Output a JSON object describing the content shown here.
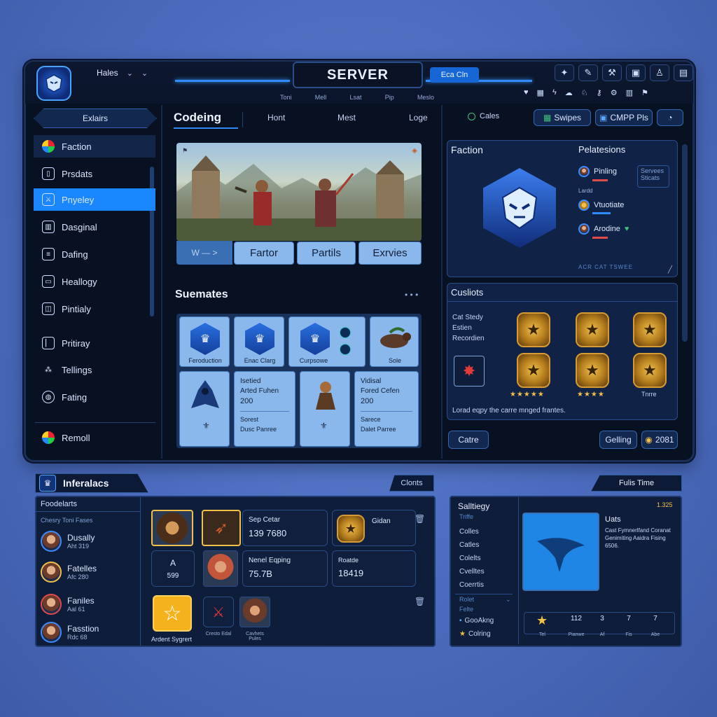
{
  "colors": {
    "accent": "#1a86ff",
    "gold": "#f1c04a",
    "panel": "#0b1426"
  },
  "header": {
    "dropdown_label": "Hales",
    "title": "SERVER",
    "sub_links": [
      "Toni",
      "Mell",
      "Lsat",
      "Pip",
      "Meslo"
    ],
    "pill_label": "Eca Cln",
    "icons": [
      "gamepad-icon",
      "pen-icon",
      "wrench-icon",
      "image-icon",
      "person-icon",
      "chart-icon"
    ],
    "sub_icons": [
      "heart-icon",
      "grid-icon",
      "bolt-icon",
      "cloud-icon",
      "person-icon",
      "key-icon",
      "gear-icon",
      "book-icon",
      "flag-icon"
    ]
  },
  "sidebar": {
    "header": "Exlairs",
    "items": [
      {
        "label": "Faction",
        "icon": "globe-icon"
      },
      {
        "label": "Prsdats",
        "icon": "document-icon"
      },
      {
        "label": "Pnyeley",
        "icon": "sword-icon"
      },
      {
        "label": "Dasginal",
        "icon": "book-icon"
      },
      {
        "label": "Dafing",
        "icon": "list-icon"
      },
      {
        "label": "Heallogy",
        "icon": "heal-icon"
      },
      {
        "label": "Pintialy",
        "icon": "cup-icon"
      },
      {
        "label": "Pritiray",
        "icon": "bar-icon"
      },
      {
        "label": "Tellings",
        "icon": "network-icon"
      },
      {
        "label": "Fating",
        "icon": "bell-icon"
      }
    ],
    "footer": "Remoll"
  },
  "center": {
    "tabs": [
      "Codeing",
      "Hont",
      "Mest",
      "Loge"
    ],
    "hero_buttons": {
      "nav": "W — >",
      "b1": "Fartor",
      "b2": "Partils",
      "b3": "Exrvies"
    },
    "section_title": "Suemates",
    "grid_top": [
      "Feroduction",
      "Enac Clarg",
      "Curpsowe",
      "Sole"
    ],
    "grid_bottom": [
      {
        "title": "Isetied",
        "line": "Arted Fuhen",
        "value": "200",
        "caption": "Sorest",
        "sub": "Dusc Panree"
      },
      {
        "title": "Vidisal",
        "line": "Fored Cefen",
        "value": "200",
        "caption": "Sarece",
        "sub": "Dalet Parree"
      }
    ]
  },
  "right_top": {
    "pill": "Cales",
    "buttons": [
      "Swipes",
      "CMPP Pls"
    ],
    "faction_title": "Faction",
    "pelations_title": "Pelatesions",
    "members": [
      {
        "name": "Pinling",
        "tag": "Servees Sticats"
      },
      {
        "name": "Vtuotiate"
      },
      {
        "name": "Arodine"
      }
    ],
    "muted_label": "Lardd",
    "footer": "ACR CAT TSWEE"
  },
  "customs": {
    "title": "Cusliots",
    "labels": [
      "Cat Stedy",
      "Estien",
      "Recordien"
    ],
    "caption": "Tnrre",
    "footer": "Lorad eqpy the carre mnged frantes.",
    "left_btn": "Catre",
    "right_btn": "Gelling",
    "count": "2081"
  },
  "bottom_left": {
    "header": "Inferalacs",
    "tag": "Clonts",
    "col_title": "Foodelarts",
    "subtitle": "Chesry Toni Fases",
    "players": [
      {
        "name": "Dusally",
        "meta": "Aht 319"
      },
      {
        "name": "Fatelles",
        "meta": "Afc 280"
      },
      {
        "name": "Faniles",
        "meta": "Aal 61"
      },
      {
        "name": "Fasstion",
        "meta": "Rdc 68"
      }
    ],
    "item1": {
      "title": "Sep Cetar",
      "value": "139 7680"
    },
    "item2": {
      "title": "A",
      "value": "599"
    },
    "item3": {
      "title": "Nenel Eqping",
      "value": "75.7B"
    },
    "item4": {
      "title": "Gidan"
    },
    "item5": {
      "title": "Roatde",
      "value": "18419"
    },
    "star_label": "Ardent Sygrert",
    "mini1": "Cresto Edal",
    "mini2": "Cavhets Pules"
  },
  "bottom_right": {
    "header": "Fulis Time",
    "title": "Salltiegy",
    "price": "1.325",
    "subhead": "Triffe",
    "list": [
      "Colles",
      "Catles",
      "Colelts",
      "Cvelltes",
      "Coerrtis"
    ],
    "section": "Rolet",
    "sec_items": [
      "Felte",
      "GooAkng",
      "Colring"
    ],
    "card_title": "Uats",
    "card_desc": "Cast Fymnerlfand Coranat Genimiting Aaidra Fising 6506.",
    "stats": [
      {
        "value": "",
        "label": "Tel"
      },
      {
        "value": "112",
        "label": "Pianwe"
      },
      {
        "value": "3",
        "label": "Af"
      },
      {
        "value": "7",
        "label": "Fis"
      },
      {
        "value": "7",
        "label": "Abe"
      }
    ]
  }
}
